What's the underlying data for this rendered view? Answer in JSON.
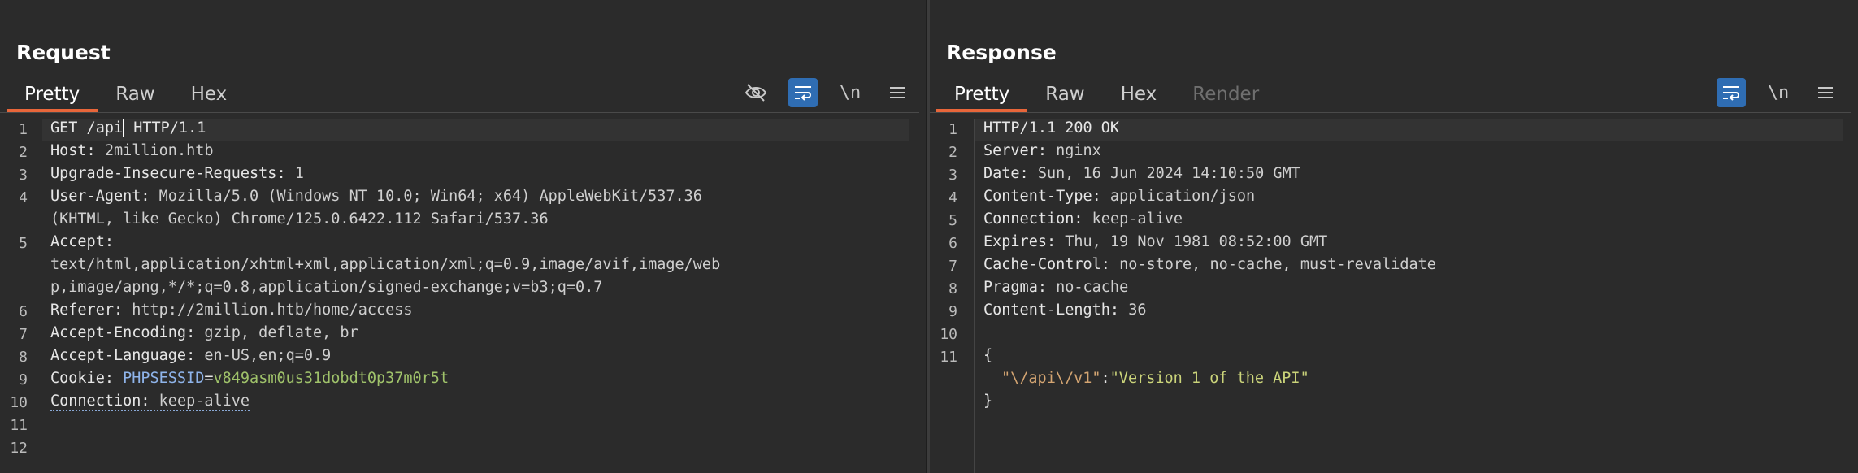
{
  "request": {
    "title": "Request",
    "tabs": [
      {
        "label": "Pretty",
        "active": true
      },
      {
        "label": "Raw",
        "active": false
      },
      {
        "label": "Hex",
        "active": false
      }
    ],
    "tools": [
      "hide-icon",
      "wrap-icon",
      "newline-toggle",
      "menu-icon"
    ],
    "newline_label": "\\n",
    "line_numbers": [
      "1",
      "2",
      "3",
      "4",
      "5",
      "6",
      "7",
      "8",
      "9",
      "10",
      "11",
      "12"
    ],
    "lines": {
      "l1_method": "GET /api",
      "l1_rest": " HTTP/1.1",
      "l2_key": "Host:",
      "l2_val": " 2million.htb",
      "l3_key": "Upgrade-Insecure-Requests:",
      "l3_val": " 1",
      "l4_key": "User-Agent:",
      "l4_val": " Mozilla/5.0 (Windows NT 10.0; Win64; x64) AppleWebKit/537.36",
      "l4_cont": "(KHTML, like Gecko) Chrome/125.0.6422.112 Safari/537.36",
      "l5_key": "Accept:",
      "l5_cont1": "text/html,application/xhtml+xml,application/xml;q=0.9,image/avif,image/web",
      "l5_cont2": "p,image/apng,*/*;q=0.8,application/signed-exchange;v=b3;q=0.7",
      "l6_key": "Referer:",
      "l6_val": " http://2million.htb/home/access",
      "l7_key": "Accept-Encoding:",
      "l7_val": " gzip, deflate, br",
      "l8_key": "Accept-Language:",
      "l8_val": " en-US,en;q=0.9",
      "l9_key": "Cookie:",
      "l9_name": "PHPSESSID",
      "l9_eq": "=",
      "l9_val": "v849asm0us31dobdt0p37m0r5t",
      "l10_key": "Connection:",
      "l10_val": " keep-alive"
    }
  },
  "response": {
    "title": "Response",
    "tabs": [
      {
        "label": "Pretty",
        "active": true
      },
      {
        "label": "Raw",
        "active": false
      },
      {
        "label": "Hex",
        "active": false
      },
      {
        "label": "Render",
        "active": false,
        "disabled": true
      }
    ],
    "newline_label": "\\n",
    "line_numbers": [
      "1",
      "2",
      "3",
      "4",
      "5",
      "6",
      "7",
      "8",
      "9",
      "10",
      "11"
    ],
    "lines": {
      "l1": "HTTP/1.1 200 OK",
      "l2_key": "Server:",
      "l2_val": " nginx",
      "l3_key": "Date:",
      "l3_val": " Sun, 16 Jun 2024 14:10:50 GMT",
      "l4_key": "Content-Type:",
      "l4_val": " application/json",
      "l5_key": "Connection:",
      "l5_val": " keep-alive",
      "l6_key": "Expires:",
      "l6_val": " Thu, 19 Nov 1981 08:52:00 GMT",
      "l7_key": "Cache-Control:",
      "l7_val": " no-store, no-cache, must-revalidate",
      "l8_key": "Pragma:",
      "l8_val": " no-cache",
      "l9_key": "Content-Length:",
      "l9_val": " 36",
      "json_open": "{",
      "json_key": "\"\\/api\\/v1\"",
      "json_colon": ":",
      "json_value": "\"Version 1 of the API\"",
      "json_close": "}"
    }
  },
  "layout_switch": [
    "side-by-side-icon",
    "stacked-icon",
    "single-pane-icon"
  ],
  "colors": {
    "accent_tab": "#e8663a",
    "toggle_on": "#2f6db3",
    "background": "#2b2b2b"
  }
}
